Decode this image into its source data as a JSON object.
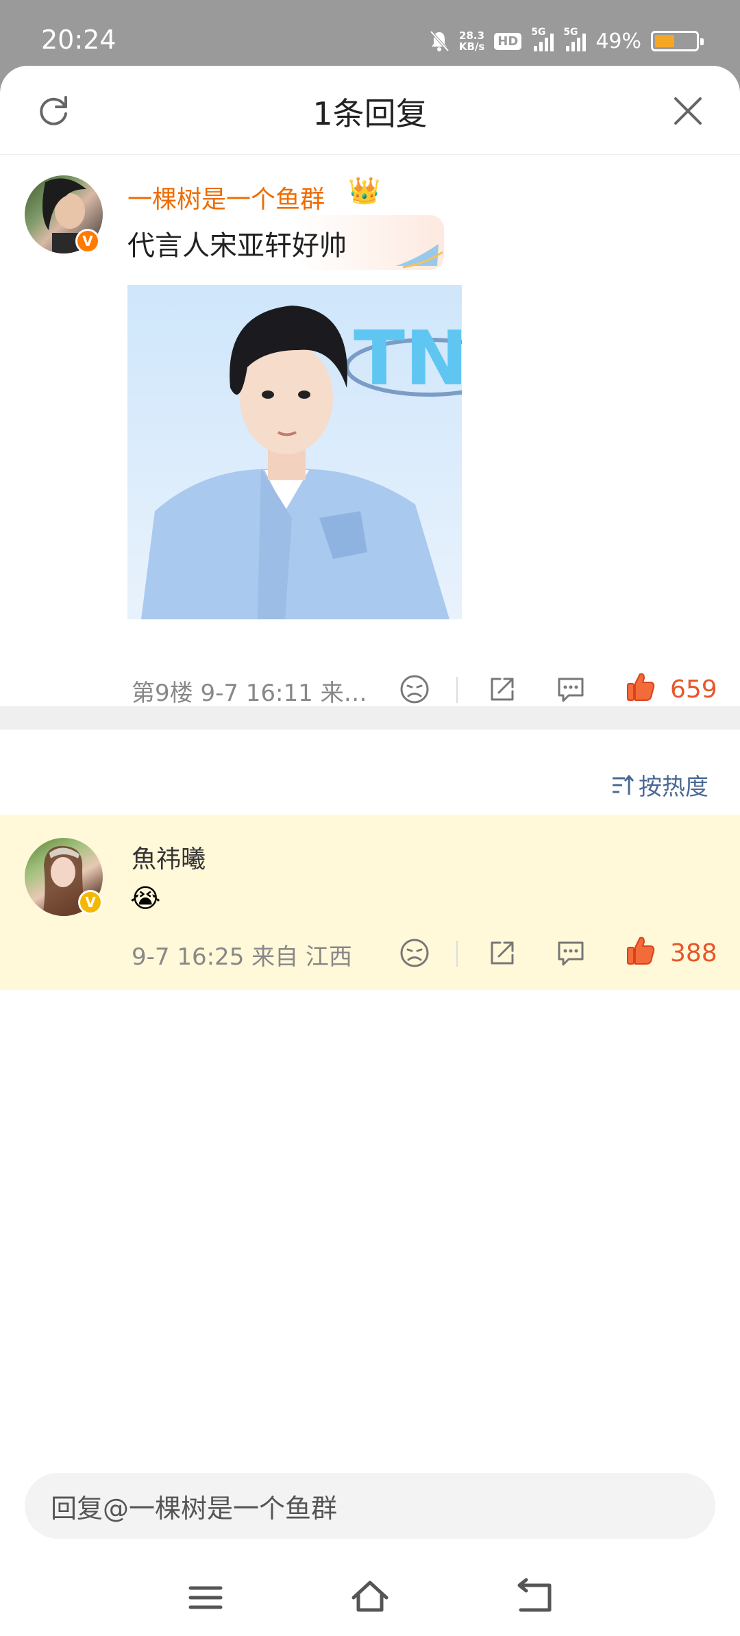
{
  "status_bar": {
    "time": "20:24",
    "net_speed_value": "28.3",
    "net_speed_unit": "KB/s",
    "hd_label": "HD",
    "signal1_label": "5G",
    "signal2_label": "5G",
    "battery_percent": "49%",
    "battery_level": 0.49,
    "battery_color": "#f5a623"
  },
  "header": {
    "title": "1条回复",
    "refresh_icon": "refresh-icon",
    "close_icon": "close-icon"
  },
  "root_comment": {
    "username": "一棵树是一个鱼群",
    "username_color": "#ef6c00",
    "crown": "👑",
    "badge": "V",
    "text": "代言人宋亚轩好帅",
    "image_text": "TN",
    "meta": "第9楼  9-7 16:11  来…",
    "like_count": "659"
  },
  "sort": {
    "label": "按热度"
  },
  "reply": {
    "username": "魚祎曦",
    "badge": "V",
    "emoji": "😭",
    "meta": "9-7 16:25  来自 江西",
    "like_count": "388"
  },
  "input": {
    "placeholder": "回复@一棵树是一个鱼群"
  },
  "accent_like": "#e8562a"
}
